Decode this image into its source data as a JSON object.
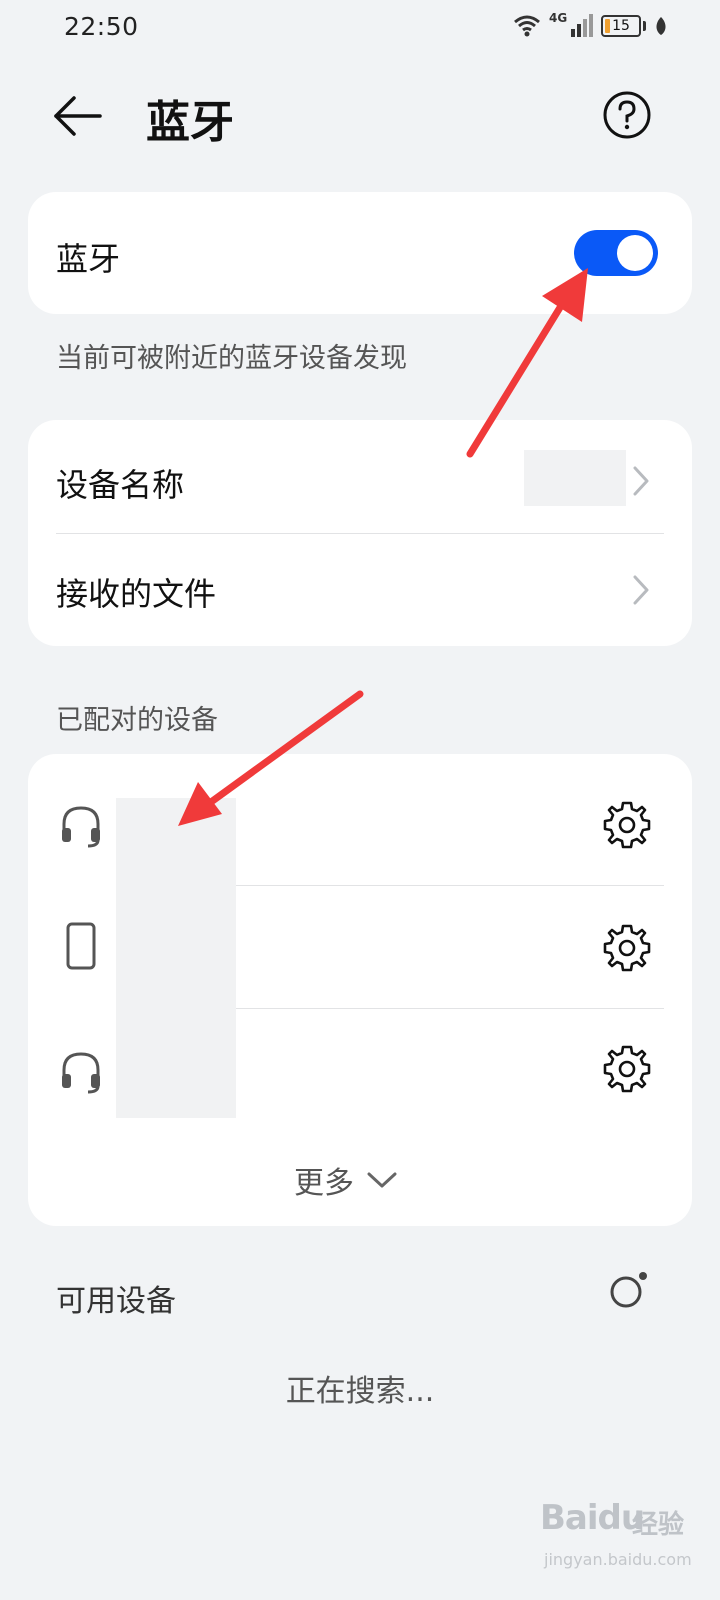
{
  "status_bar": {
    "time": "22:50",
    "network": "4G",
    "battery_percent": "15",
    "battery_level": 0.15,
    "battery_color": "#f0a030"
  },
  "header": {
    "title": "蓝牙",
    "back_icon": "arrow-left-icon",
    "help_icon": "help-circle-icon"
  },
  "bluetooth": {
    "label": "蓝牙",
    "enabled": true,
    "toggle_color": "#0a59f7",
    "visibility_hint": "当前可被附近的蓝牙设备发现"
  },
  "settings": {
    "device_name_label": "设备名称",
    "received_files_label": "接收的文件"
  },
  "paired": {
    "section_title": "已配对的设备",
    "devices": [
      {
        "icon": "headset-icon",
        "name": ""
      },
      {
        "icon": "phone-icon",
        "name": ""
      },
      {
        "icon": "headset-icon",
        "name": ""
      }
    ],
    "more_label": "更多"
  },
  "available": {
    "section_title": "可用设备",
    "searching_text": "正在搜索..."
  },
  "watermark": {
    "brand": "Baidu",
    "label": "经验",
    "url": "jingyan.baidu.com"
  },
  "annotation_color": "#f03a3a"
}
